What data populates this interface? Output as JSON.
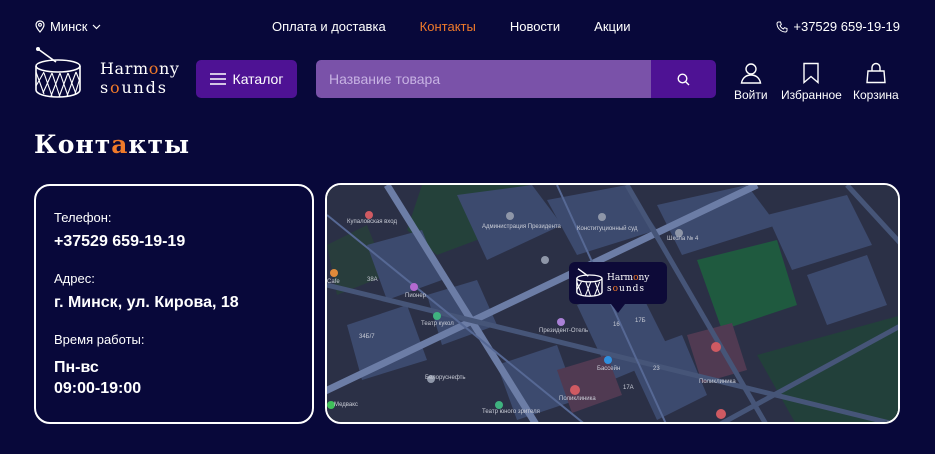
{
  "topbar": {
    "city": "Минск",
    "nav": [
      {
        "label": "Оплата и доставка",
        "active": false
      },
      {
        "label": "Контакты",
        "active": true
      },
      {
        "label": "Новости",
        "active": false
      },
      {
        "label": "Акции",
        "active": false
      }
    ],
    "phone": "+37529 659-19-19"
  },
  "header": {
    "logo_line1_a": "Harm",
    "logo_line1_b": "o",
    "logo_line1_c": "ny",
    "logo_line2_a": "s",
    "logo_line2_b": "o",
    "logo_line2_c": "unds",
    "catalog_label": "Каталог",
    "search_placeholder": "Название товара",
    "actions": [
      {
        "label": "Войти",
        "icon": "user-icon"
      },
      {
        "label": "Избранное",
        "icon": "bookmark-icon"
      },
      {
        "label": "Корзина",
        "icon": "bag-icon"
      }
    ]
  },
  "page": {
    "title_a": "Конт",
    "title_b": "а",
    "title_c": "кты"
  },
  "contacts": {
    "phone_label": "Телефон:",
    "phone_value": "+37529 659-19-19",
    "address_label": "Адрес:",
    "address_value": "г. Минск, ул. Кирова, 18",
    "hours_label": "Время работы:",
    "hours_days": "Пн-вс",
    "hours_time": "09:00-19:00"
  },
  "map": {
    "labels": [
      "Купаловская вход",
      "Администрация Президента",
      "Конституционный суд",
      "Школа № 4",
      "Пионер",
      "Театр кукол",
      "Президент-Отель",
      "Бассейн",
      "Поликлиника",
      "Поликлиника",
      "Белоруснефть",
      "Медвакс",
      "Театр юного зрителя",
      "Cafe",
      "38А",
      "34Б/7",
      "16",
      "17А",
      "23",
      "17Б"
    ]
  },
  "colors": {
    "background": "#08083a",
    "accent": "#f07a2a",
    "button": "#4e1294",
    "search_bg": "#7a52a9"
  }
}
